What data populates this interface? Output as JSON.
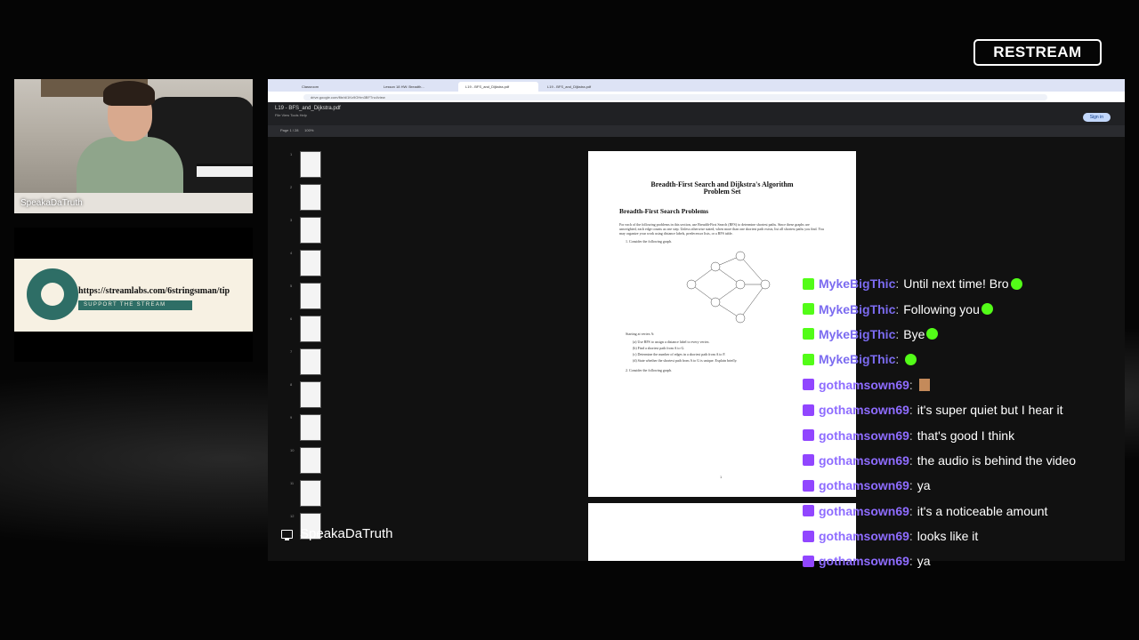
{
  "brand": {
    "name": "RESTREAM"
  },
  "camera": {
    "label": "SpeakaDaTruth"
  },
  "tip": {
    "url": "https://streamlabs.com/6stringsıman/tip",
    "cta": "SUPPORT THE STREAM"
  },
  "caption": {
    "name": "SpeakaDaTruth"
  },
  "browser": {
    "tabs": [
      "Classroom",
      "Lesson 18 HW: Breadth...",
      "L19 - BFS_and_Dijkstra.pdf",
      "L19 - BFS_and_Dijkstra.pdf"
    ],
    "url": "drive.google.com/file/d/1Kx9OHm3BFTncI/view",
    "signin": "Sign in"
  },
  "pdf": {
    "filename": "L19 - BFS_and_Dijkstra.pdf",
    "menu": "File   View   Tools   Help",
    "page_label": "Page",
    "page_current": "1",
    "page_total": "/ 28",
    "zoom": "100%",
    "title_line1": "Breadth-First Search and Dijkstra's Algorithm",
    "title_line2": "Problem Set",
    "section": "Breadth-First Search Problems",
    "intro": "For each of the following problems in this section, use Breadth-First Search (BFS) to determine shortest paths. Since these graphs are unweighted, each edge counts as one step. Unless otherwise stated, when more than one shortest path exists, list all shortest paths you find. You may organize your work using distance labels, predecessor lists, or a BFS table.",
    "q1": "1. Consider the following graph.",
    "start": "Starting at vertex A:",
    "items": [
      "(a) Use BFS to assign a distance label to every vertex.",
      "(b) Find a shortest path from A to G.",
      "(c) Determine the number of edges in a shortest path from A to F.",
      "(d) State whether the shortest path from A to G is unique. Explain briefly."
    ],
    "q2": "2. Consider the following graph.",
    "page_no": "1",
    "thumb_numbers": [
      "1",
      "2",
      "3",
      "4",
      "5",
      "6",
      "7",
      "8",
      "9",
      "10",
      "11",
      "12"
    ]
  },
  "chat": [
    {
      "platform": "kick",
      "user": "MykeBigThic",
      "text": "Until next time! Bro",
      "emote": "kick"
    },
    {
      "platform": "kick",
      "user": "MykeBigThic",
      "text": "Following you",
      "emote": "kick"
    },
    {
      "platform": "kick",
      "user": "MykeBigThic",
      "text": "Bye",
      "emote": "kick"
    },
    {
      "platform": "kick",
      "user": "MykeBigThic",
      "text": "",
      "emote": "kick"
    },
    {
      "platform": "twitch",
      "user": "gothamsown69",
      "text": "",
      "emote": "person"
    },
    {
      "platform": "twitch",
      "user": "gothamsown69",
      "text": "it's super quiet but I hear it",
      "emote": ""
    },
    {
      "platform": "twitch",
      "user": "gothamsown69",
      "text": "that's good I think",
      "emote": ""
    },
    {
      "platform": "twitch",
      "user": "gothamsown69",
      "text": "the audio is behind the video",
      "emote": ""
    },
    {
      "platform": "twitch",
      "user": "gothamsown69",
      "text": "ya",
      "emote": ""
    },
    {
      "platform": "twitch",
      "user": "gothamsown69",
      "text": "it's a noticeable amount",
      "emote": ""
    },
    {
      "platform": "twitch",
      "user": "gothamsown69",
      "text": "looks like it",
      "emote": ""
    },
    {
      "platform": "twitch",
      "user": "gothamsown69",
      "text": "ya",
      "emote": ""
    }
  ],
  "colors": {
    "kick": "#53fc18",
    "twitch": "#9146ff",
    "username": "#7b6bf0"
  }
}
